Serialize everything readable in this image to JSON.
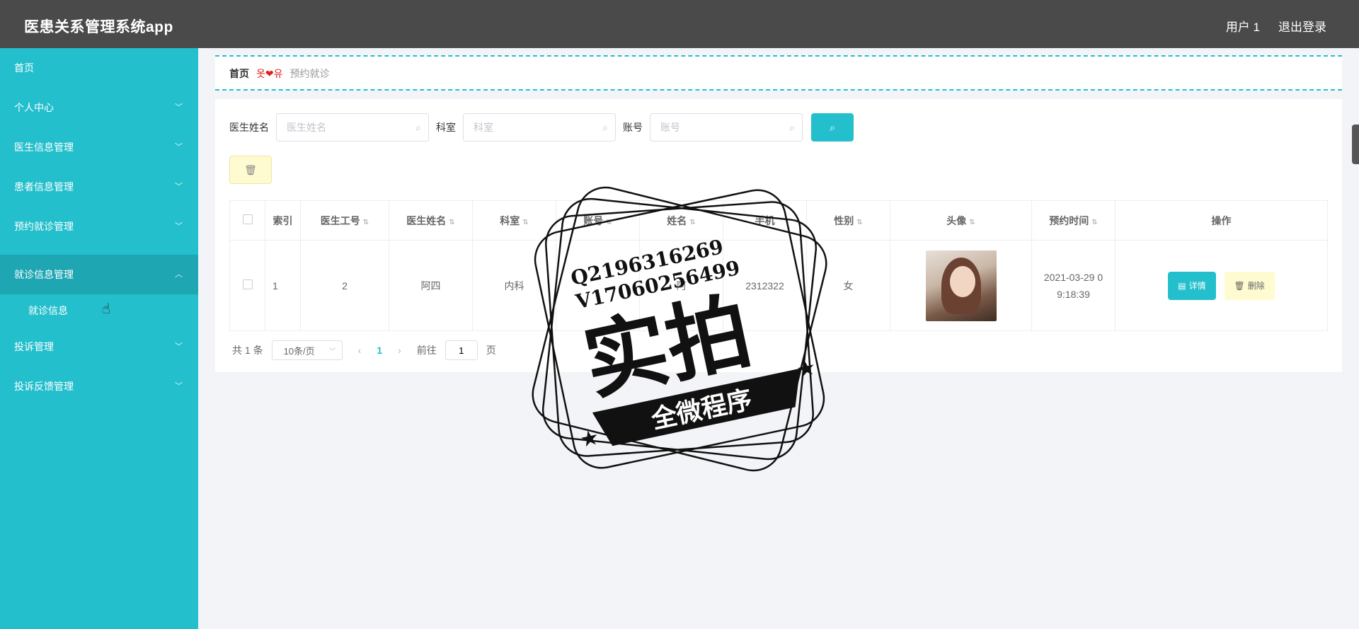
{
  "header": {
    "app_title": "医患关系管理系统app",
    "user_label": "用户 1",
    "logout_label": "退出登录"
  },
  "sidebar": {
    "items": [
      {
        "label": "首页"
      },
      {
        "label": "个人中心"
      },
      {
        "label": "医生信息管理"
      },
      {
        "label": "患者信息管理"
      },
      {
        "label": "预约就诊管理"
      },
      {
        "label": "就诊信息管理"
      },
      {
        "label": "投诉管理"
      },
      {
        "label": "投诉反馈管理"
      }
    ],
    "sub_item": "就诊信息"
  },
  "breadcrumb": {
    "home": "首页",
    "separator": "옷❤유",
    "current": "预约就诊"
  },
  "search": {
    "doctor_name_label": "医生姓名",
    "doctor_name_placeholder": "医生姓名",
    "dept_label": "科室",
    "dept_placeholder": "科室",
    "account_label": "账号",
    "account_placeholder": "账号"
  },
  "table": {
    "headers": [
      "索引",
      "医生工号",
      "医生姓名",
      "科室",
      "账号",
      "姓名",
      "手机",
      "性别",
      "头像",
      "预约时间",
      "操作"
    ],
    "rows": [
      {
        "index": "1",
        "doctor_id": "2",
        "doctor_name": "阿四",
        "dept": "内科",
        "account": "",
        "name": "阿",
        "phone": "2312322",
        "gender": "女",
        "time": "2021-03-29 0 9:18:39"
      }
    ],
    "detail_label": "详情",
    "delete_label": "删除"
  },
  "pager": {
    "total": "共 1 条",
    "page_size": "10条/页",
    "current_page": "1",
    "goto_label": "前往",
    "goto_value": "1",
    "page_unit": "页"
  },
  "watermark": {
    "line1": "Q2196316269",
    "line2": "V17060256499",
    "big": "实拍",
    "ribbon": "全微程序"
  },
  "colors": {
    "accent": "#24bfcc",
    "header_bg": "#4a4a4a",
    "warn_bg": "#fffbd0"
  }
}
